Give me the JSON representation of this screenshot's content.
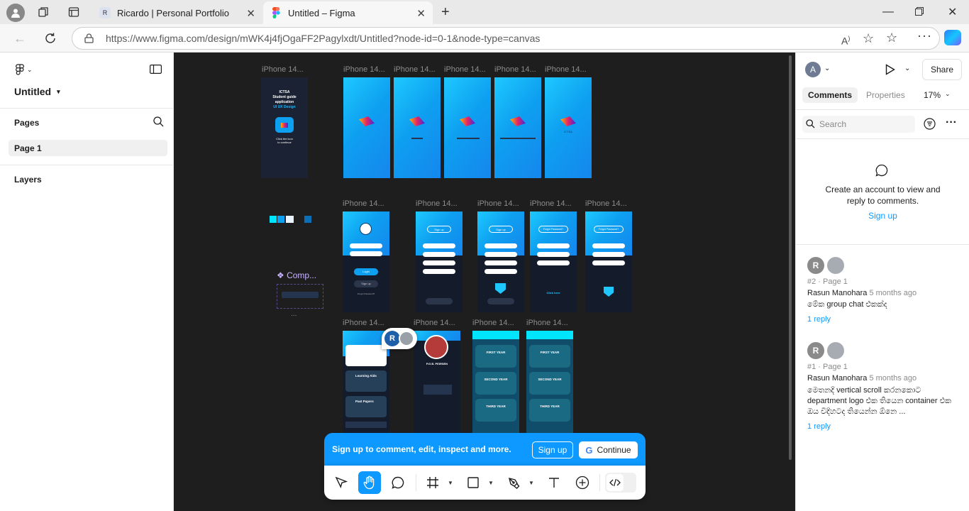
{
  "browser": {
    "tabs": [
      {
        "title": "Ricardo | Personal Portfolio",
        "favicon": "R"
      },
      {
        "title": "Untitled – Figma"
      }
    ],
    "url": "https://www.figma.com/design/mWK4j4fjOgaFF2Pagylxdt/Untitled?node-id=0-1&node-type=canvas"
  },
  "left_panel": {
    "file_name": "Untitled",
    "pages_heading": "Pages",
    "pages": [
      "Page 1"
    ],
    "layers_heading": "Layers"
  },
  "canvas": {
    "frame_label": "iPhone 14...",
    "component_label": "❖ Comp...",
    "ellipsis": "...",
    "splash_texts": {
      "line1": "ICTSA",
      "line2": "Student guide",
      "line3": "application",
      "line4": "UI UX Design",
      "line5": "Click the icon",
      "line6": "to continue"
    },
    "login_button": "Login",
    "signup_button": "Sign up",
    "forgot_password": "Forgot Password?",
    "click_here": "Click here",
    "learning_aids": "Learning Aids",
    "past_papers": "Past Papers",
    "year_labels": [
      "FIRST YEAR",
      "SECOND YEAR",
      "THIRD YEAR"
    ],
    "profile_name": "P.G.B. PEIRSEN",
    "avatar_initial": "R"
  },
  "right_panel": {
    "avatar_initial": "A",
    "share_label": "Share",
    "tabs": [
      "Comments",
      "Properties"
    ],
    "zoom": "17%",
    "search_placeholder": "Search",
    "empty_message": "Create an account to view and reply to comments.",
    "sign_up_link": "Sign up",
    "comments": [
      {
        "index": "#2 · Page 1",
        "author": "Rasun Manohara",
        "time": "5 months ago",
        "text": "මේක group chat එකක්ද",
        "reply": "1 reply",
        "initial": "R"
      },
      {
        "index": "#1 · Page 1",
        "author": "Rasun Manohara",
        "time": "5 months ago",
        "text": "මෙතනදි vertical scroll කරනකොට department logo එක තියෙන container එක ඔය විදිහටද තියෙන්න ඕනෙ ...",
        "reply": "1 reply",
        "initial": "R"
      }
    ]
  },
  "banner": {
    "message": "Sign up to comment, edit, inspect and more.",
    "signup_button": "Sign up",
    "continue_button": "Continue",
    "google_letter": "G"
  },
  "colors": {
    "figma_blue": "#0d99ff",
    "canvas_bg": "#1e1e1e",
    "swatches": [
      "#00e5ff",
      "#0ea0f0",
      "#e8f4ff",
      "#0b6fb8"
    ]
  }
}
